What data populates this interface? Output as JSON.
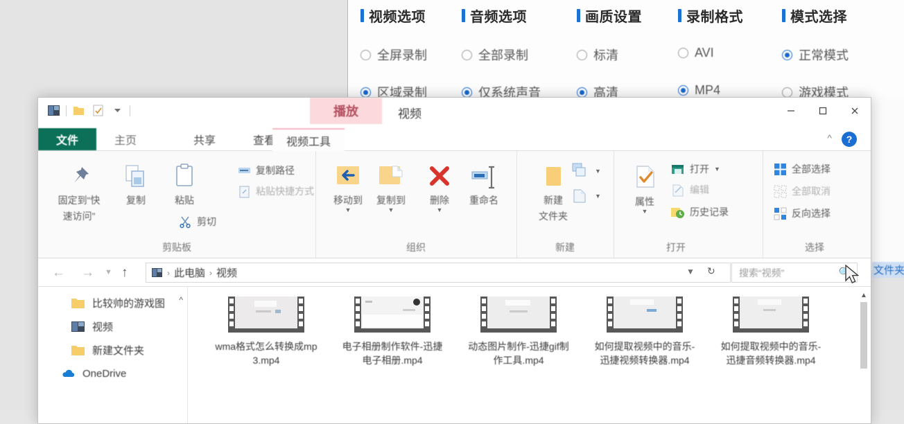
{
  "background_recorder": {
    "columns": [
      {
        "heading": "视频选项",
        "options": [
          {
            "label": "全屏录制",
            "selected": false
          },
          {
            "label": "区域录制",
            "selected": true
          }
        ]
      },
      {
        "heading": "音频选项",
        "options": [
          {
            "label": "全部录制",
            "selected": false
          },
          {
            "label": "仅系统声音",
            "selected": true
          }
        ]
      },
      {
        "heading": "画质设置",
        "options": [
          {
            "label": "标清",
            "selected": false
          },
          {
            "label": "高清",
            "selected": true
          }
        ]
      },
      {
        "heading": "录制格式",
        "options": [
          {
            "label": "AVI",
            "selected": false
          },
          {
            "label": "MP4",
            "selected": true
          }
        ]
      },
      {
        "heading": "模式选择",
        "options": [
          {
            "label": "正常模式",
            "selected": true
          },
          {
            "label": "游戏模式",
            "selected": false
          }
        ]
      }
    ],
    "accent_color": "#1769d0"
  },
  "explorer": {
    "titlebar": {
      "contextual_tab_label": "播放",
      "window_title": "视频",
      "quick_access_icons": [
        "explorer-icon",
        "folder-icon",
        "properties-icon",
        "customize-chevron-icon"
      ],
      "minimize_label": "最小化",
      "maximize_label": "最大化",
      "close_label": "关闭"
    },
    "tabs": [
      {
        "id": "file",
        "label": "文件",
        "active": false,
        "style": "file"
      },
      {
        "id": "home",
        "label": "主页",
        "active": true,
        "style": "normal"
      },
      {
        "id": "share",
        "label": "共享",
        "active": false,
        "style": "normal"
      },
      {
        "id": "view",
        "label": "查看",
        "active": false,
        "style": "normal"
      },
      {
        "id": "video-tools",
        "label": "视频工具",
        "active": false,
        "style": "contextual"
      }
    ],
    "help_label": "?",
    "ribbon": {
      "groups": [
        {
          "id": "clipboard",
          "label": "剪贴板",
          "big_buttons": [
            {
              "id": "pin-to-quick-access",
              "label_line1": "固定到“快",
              "label_line2": "速访问”",
              "icon": "pin-icon"
            },
            {
              "id": "copy",
              "label_line1": "复制",
              "label_line2": "",
              "icon": "copy-icon"
            },
            {
              "id": "paste",
              "label_line1": "粘贴",
              "label_line2": "",
              "icon": "paste-icon"
            }
          ],
          "small_buttons": [
            {
              "id": "copy-path",
              "label": "复制路径",
              "icon": "copy-path-icon",
              "dim": false
            },
            {
              "id": "paste-shortcut",
              "label": "粘贴快捷方式",
              "icon": "paste-shortcut-icon",
              "dim": true
            },
            {
              "id": "cut",
              "label": "剪切",
              "icon": "scissors-icon",
              "dim": false
            }
          ]
        },
        {
          "id": "organize",
          "label": "组织",
          "big_buttons": [
            {
              "id": "move-to",
              "label_line1": "移动到",
              "label_line2": "",
              "icon": "move-to-icon"
            },
            {
              "id": "copy-to",
              "label_line1": "复制到",
              "label_line2": "",
              "icon": "copy-to-icon"
            },
            {
              "id": "delete",
              "label_line1": "删除",
              "label_line2": "",
              "icon": "delete-x-icon"
            },
            {
              "id": "rename",
              "label_line1": "重命名",
              "label_line2": "",
              "icon": "rename-icon"
            }
          ],
          "small_buttons": []
        },
        {
          "id": "new",
          "label": "新建",
          "big_buttons": [
            {
              "id": "new-folder",
              "label_line1": "新建",
              "label_line2": "文件夹",
              "icon": "new-folder-icon"
            }
          ],
          "small_buttons": [
            {
              "id": "new-item",
              "label": "",
              "icon": "new-item-icon",
              "dim": false
            },
            {
              "id": "easy-access",
              "label": "",
              "icon": "easy-access-icon",
              "dim": false
            }
          ]
        },
        {
          "id": "open",
          "label": "打开",
          "big_buttons": [
            {
              "id": "properties",
              "label_line1": "属性",
              "label_line2": "",
              "icon": "properties-check-icon"
            }
          ],
          "small_buttons": [
            {
              "id": "open",
              "label": "打开",
              "icon": "open-icon",
              "dim": false
            },
            {
              "id": "edit",
              "label": "编辑",
              "icon": "edit-icon",
              "dim": true
            },
            {
              "id": "history",
              "label": "历史记录",
              "icon": "history-icon",
              "dim": false
            }
          ]
        },
        {
          "id": "select",
          "label": "选择",
          "big_buttons": [],
          "small_buttons": [
            {
              "id": "select-all",
              "label": "全部选择",
              "icon": "select-all-icon",
              "dim": false
            },
            {
              "id": "select-none",
              "label": "全部取消",
              "icon": "select-none-icon",
              "dim": true
            },
            {
              "id": "invert-selection",
              "label": "反向选择",
              "icon": "invert-selection-icon",
              "dim": false
            }
          ]
        }
      ]
    },
    "address_bar": {
      "back_label": "后退",
      "forward_label": "前进",
      "up_label": "向上",
      "breadcrumbs": [
        "此电脑",
        "视频"
      ],
      "separator": "›",
      "refresh_label": "刷新",
      "search_placeholder": "搜索“视频”"
    },
    "nav_pane": {
      "items": [
        {
          "id": "game-pics",
          "label": "比较帅的游戏图",
          "icon": "folder-icon"
        },
        {
          "id": "videos",
          "label": "视频",
          "icon": "videos-folder-icon"
        },
        {
          "id": "new-folder",
          "label": "新建文件夹",
          "icon": "folder-icon"
        },
        {
          "id": "onedrive",
          "label": "OneDrive",
          "icon": "onedrive-icon"
        }
      ]
    },
    "files": [
      {
        "id": "f1",
        "name": "wma格式怎么转换成mp3.mp4",
        "icon": "video-thumbnail"
      },
      {
        "id": "f2",
        "name": "电子相册制作软件-迅捷电子相册.mp4",
        "icon": "video-thumbnail"
      },
      {
        "id": "f3",
        "name": "动态图片制作-迅捷gif制作工具.mp4",
        "icon": "video-thumbnail"
      },
      {
        "id": "f4",
        "name": "如何提取视频中的音乐-迅捷视频转换器.mp4",
        "icon": "video-thumbnail"
      },
      {
        "id": "f5",
        "name": "如何提取视频中的音乐-迅捷音频转换器.mp4",
        "icon": "video-thumbnail"
      }
    ]
  },
  "occluded": {
    "partial_label": "文件夹"
  }
}
